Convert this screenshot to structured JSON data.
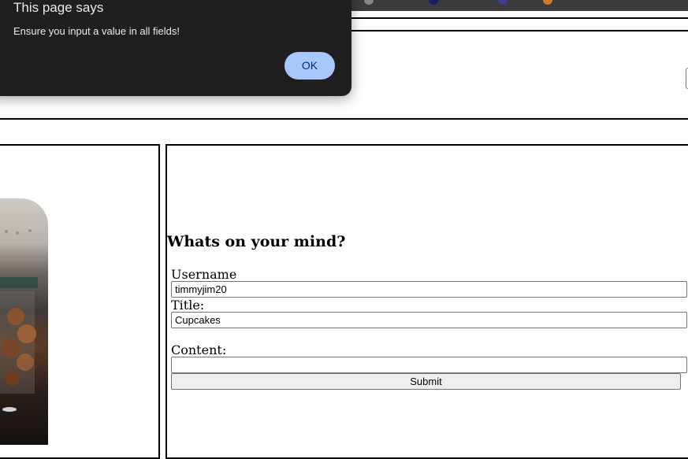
{
  "dialog": {
    "title": "This page says",
    "message": "Ensure you input a value in all fields!",
    "ok_label": "OK"
  },
  "form": {
    "heading": "Whats on your mind?",
    "username_label": "Username",
    "username_value": "timmyjim20",
    "title_label": "Title:",
    "title_value": "Cupcakes",
    "content_label": "Content:",
    "content_value": "",
    "submit_label": "Submit"
  },
  "colors": {
    "dialog_bg": "#1f1f1f",
    "ok_button_bg": "#a8c7fa",
    "ok_button_text": "#062e6f"
  }
}
